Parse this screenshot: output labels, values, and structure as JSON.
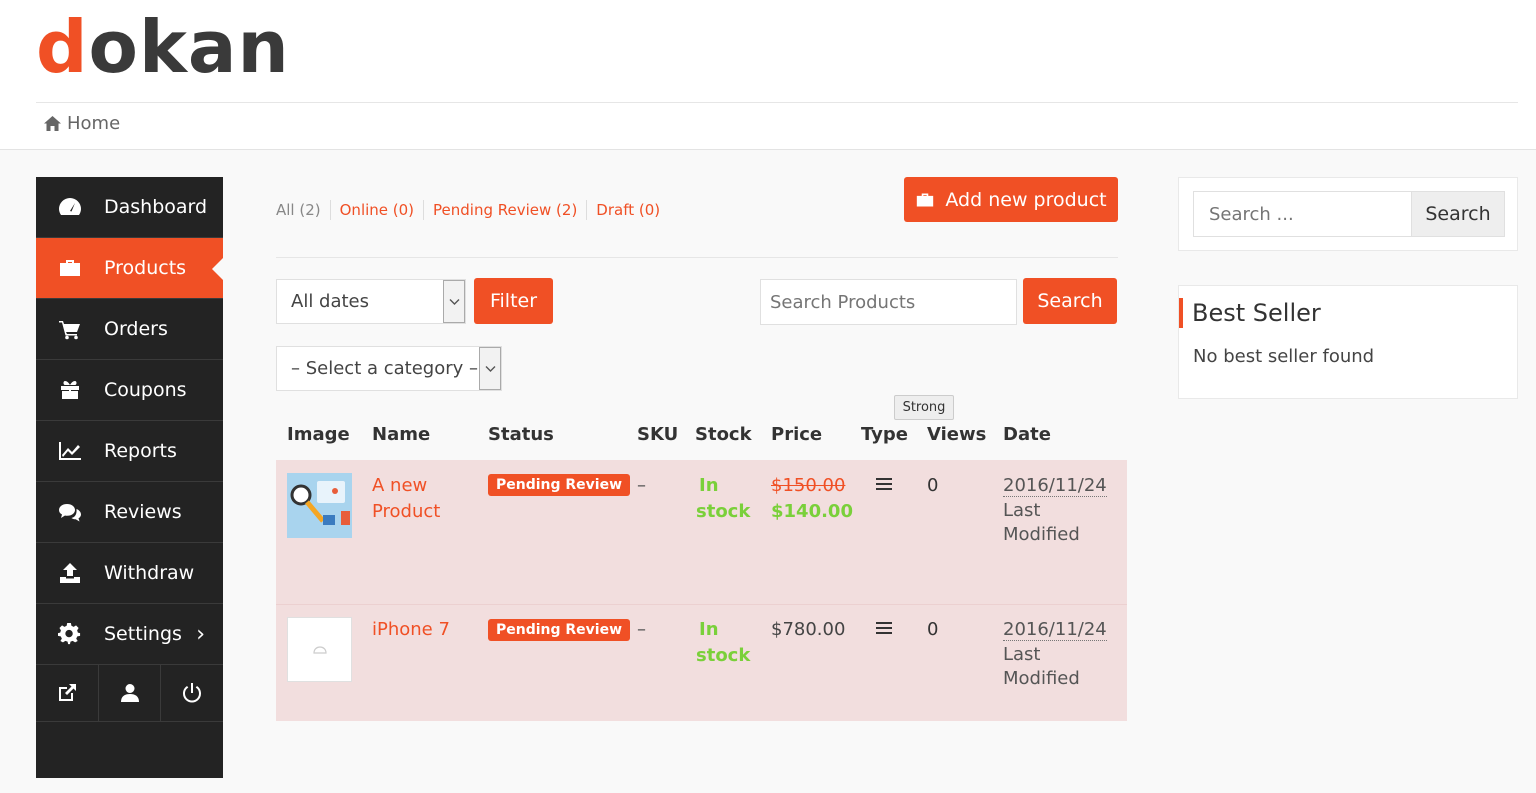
{
  "brand": {
    "logo_first": "d",
    "logo_rest": "okan",
    "accent": "#f05025",
    "dark": "#232323"
  },
  "breadcrumb": {
    "home_icon": "home-icon",
    "label": "Home"
  },
  "sidebar": {
    "items": [
      {
        "label": "Dashboard",
        "icon": "dashboard-icon"
      },
      {
        "label": "Products",
        "icon": "briefcase-icon",
        "active": true
      },
      {
        "label": "Orders",
        "icon": "cart-icon"
      },
      {
        "label": "Coupons",
        "icon": "gift-icon"
      },
      {
        "label": "Reports",
        "icon": "chart-line-icon"
      },
      {
        "label": "Reviews",
        "icon": "comments-icon"
      },
      {
        "label": "Withdraw",
        "icon": "upload-icon"
      },
      {
        "label": "Settings",
        "icon": "gear-icon"
      }
    ],
    "settings_chevron": "›",
    "bottom_icons": [
      "external-link-icon",
      "user-icon",
      "power-icon"
    ]
  },
  "filters": {
    "all": "All (2)",
    "online": "Online (0)",
    "pending": "Pending Review (2)",
    "draft": "Draft (0)"
  },
  "add_product_label": "Add new product",
  "date_select": {
    "selected": "All dates"
  },
  "filter_label": "Filter",
  "category_select": {
    "selected": "– Select a category –"
  },
  "search_products": {
    "placeholder": "Search Products",
    "button": "Search"
  },
  "tooltip": "Strong",
  "table": {
    "headers": [
      "Image",
      "Name",
      "Status",
      "SKU",
      "Stock",
      "Price",
      "Type",
      "Views",
      "Date"
    ],
    "rows": [
      {
        "name_line1": "A new",
        "name_line2": "Product",
        "status": "Pending Review",
        "sku": "–",
        "stock_line1": "In",
        "stock_line2": "stock",
        "price_old": "$150.00",
        "price_new": "$140.00",
        "type_icon": "list-icon",
        "views": "0",
        "date": "2016/11/24",
        "date_note_1": "Last",
        "date_note_2": "Modified"
      },
      {
        "name_line1": "iPhone 7",
        "status": "Pending Review",
        "sku": "–",
        "stock_line1": "In",
        "stock_line2": "stock",
        "price": "$780.00",
        "type_icon": "list-icon",
        "views": "0",
        "date": "2016/11/24",
        "date_note_1": "Last",
        "date_note_2": "Modified"
      }
    ]
  },
  "sidebar_widgets": {
    "search": {
      "placeholder": "Search ...",
      "button": "Search"
    },
    "best_seller": {
      "title": "Best Seller",
      "message": "No best seller found"
    }
  }
}
